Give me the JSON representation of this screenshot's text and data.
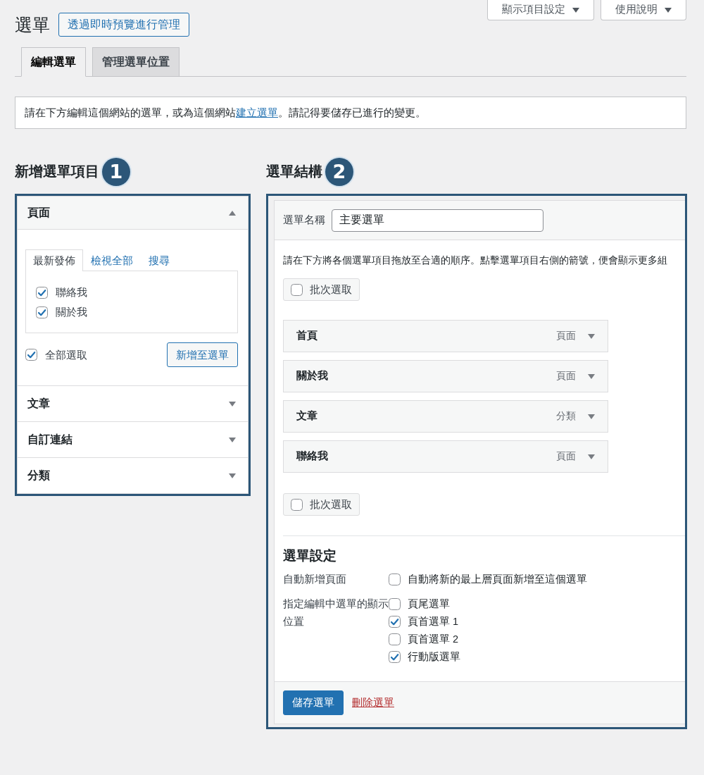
{
  "page_title": "選單",
  "live_preview_button": "透過即時預覽進行管理",
  "screen_buttons": [
    "顯示項目設定",
    "使用說明"
  ],
  "tabs": [
    {
      "label": "編輯選單",
      "selected": true
    },
    {
      "label": "管理選單位置",
      "selected": false
    }
  ],
  "notice": {
    "before": "請在下方編輯這個網站的選單，或為這個網站",
    "link": "建立選單",
    "after": "。請記得要儲存已進行的變更。"
  },
  "add_menu_items": {
    "heading": "新增選單項目",
    "step": "1",
    "sections": [
      {
        "title": "頁面",
        "expanded": true,
        "tabs": [
          {
            "label": "最新發佈",
            "selected": true
          },
          {
            "label": "檢視全部",
            "selected": false
          },
          {
            "label": "搜尋",
            "selected": false
          }
        ],
        "items": [
          {
            "label": "聯絡我",
            "checked": true
          },
          {
            "label": "關於我",
            "checked": true
          }
        ],
        "select_all": {
          "label": "全部選取",
          "checked": true
        },
        "add_button": "新增至選單"
      },
      {
        "title": "文章",
        "expanded": false
      },
      {
        "title": "自訂連結",
        "expanded": false
      },
      {
        "title": "分類",
        "expanded": false
      }
    ]
  },
  "menu_structure": {
    "heading": "選單結構",
    "step": "2",
    "name_label": "選單名稱",
    "name_value": "主要選單",
    "instructions": "請在下方將各個選單項目拖放至合適的順序。點擊選單項目右側的箭號，便會顯示更多組",
    "bulk_select_top": {
      "label": "批次選取",
      "checked": false
    },
    "items": [
      {
        "title": "首頁",
        "type": "頁面"
      },
      {
        "title": "關於我",
        "type": "頁面"
      },
      {
        "title": "文章",
        "type": "分類"
      },
      {
        "title": "聯絡我",
        "type": "頁面"
      }
    ],
    "bulk_select_bottom": {
      "label": "批次選取",
      "checked": false
    },
    "settings": {
      "heading": "選單設定",
      "rows": [
        {
          "label": "自動新增頁面",
          "options": [
            {
              "label": "自動將新的最上層頁面新增至這個選單",
              "checked": false
            }
          ]
        },
        {
          "label": "指定編輯中選單的顯示位置",
          "options": [
            {
              "label": "頁尾選單",
              "checked": false
            },
            {
              "label": "頁首選單 1",
              "checked": true
            },
            {
              "label": "頁首選單 2",
              "checked": false
            },
            {
              "label": "行動版選單",
              "checked": true
            }
          ]
        }
      ]
    },
    "save_button": "儲存選單",
    "delete_link": "刪除選單"
  }
}
